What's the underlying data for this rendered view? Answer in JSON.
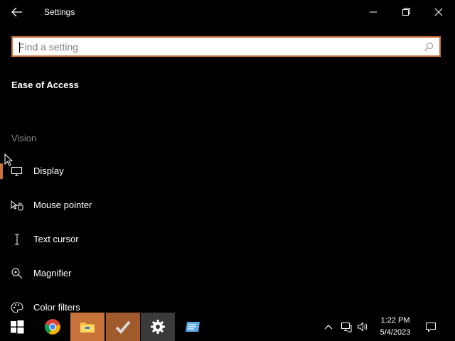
{
  "window": {
    "title": "Settings"
  },
  "search": {
    "placeholder": "Find a setting",
    "value": ""
  },
  "section": {
    "title": "Ease of Access"
  },
  "nav": {
    "group_label": "Vision",
    "items": [
      {
        "label": "Display",
        "icon": "display-icon",
        "active": true
      },
      {
        "label": "Mouse pointer",
        "icon": "mouse-pointer-icon",
        "active": false
      },
      {
        "label": "Text cursor",
        "icon": "text-cursor-icon",
        "active": false
      },
      {
        "label": "Magnifier",
        "icon": "magnifier-icon",
        "active": false
      },
      {
        "label": "Color filters",
        "icon": "color-filters-icon",
        "active": false
      }
    ]
  },
  "taskbar": {
    "pinned": [
      {
        "name": "start",
        "icon": "windows-logo-icon"
      },
      {
        "name": "chrome",
        "icon": "chrome-icon"
      },
      {
        "name": "file-explorer",
        "icon": "folder-icon"
      },
      {
        "name": "tasks",
        "icon": "checkmark-icon"
      },
      {
        "name": "settings",
        "icon": "gear-icon"
      },
      {
        "name": "app",
        "icon": "app-window-icon"
      }
    ],
    "clock": {
      "time": "1:22 PM",
      "date": "5/4/2023"
    }
  },
  "colors": {
    "accent": "#c8733a",
    "background": "#000000",
    "muted_text": "#8a8a8a"
  }
}
